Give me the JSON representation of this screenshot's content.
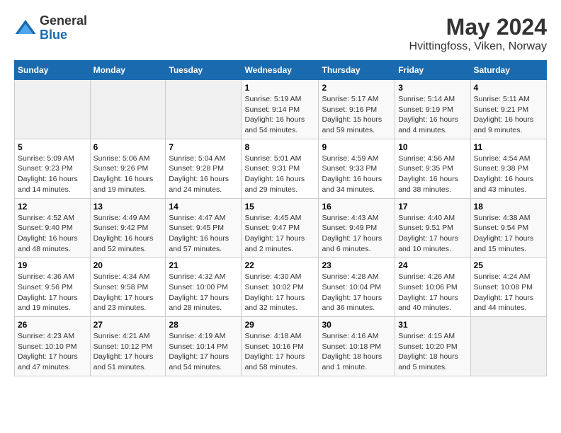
{
  "logo": {
    "general": "General",
    "blue": "Blue"
  },
  "title": "May 2024",
  "subtitle": "Hvittingfoss, Viken, Norway",
  "weekdays": [
    "Sunday",
    "Monday",
    "Tuesday",
    "Wednesday",
    "Thursday",
    "Friday",
    "Saturday"
  ],
  "weeks": [
    [
      {
        "day": "",
        "sunrise": "",
        "sunset": "",
        "daylight": ""
      },
      {
        "day": "",
        "sunrise": "",
        "sunset": "",
        "daylight": ""
      },
      {
        "day": "",
        "sunrise": "",
        "sunset": "",
        "daylight": ""
      },
      {
        "day": "1",
        "sunrise": "Sunrise: 5:19 AM",
        "sunset": "Sunset: 9:14 PM",
        "daylight": "Daylight: 16 hours and 54 minutes."
      },
      {
        "day": "2",
        "sunrise": "Sunrise: 5:17 AM",
        "sunset": "Sunset: 9:16 PM",
        "daylight": "Daylight: 15 hours and 59 minutes."
      },
      {
        "day": "3",
        "sunrise": "Sunrise: 5:14 AM",
        "sunset": "Sunset: 9:19 PM",
        "daylight": "Daylight: 16 hours and 4 minutes."
      },
      {
        "day": "4",
        "sunrise": "Sunrise: 5:11 AM",
        "sunset": "Sunset: 9:21 PM",
        "daylight": "Daylight: 16 hours and 9 minutes."
      }
    ],
    [
      {
        "day": "5",
        "sunrise": "Sunrise: 5:09 AM",
        "sunset": "Sunset: 9:23 PM",
        "daylight": "Daylight: 16 hours and 14 minutes."
      },
      {
        "day": "6",
        "sunrise": "Sunrise: 5:06 AM",
        "sunset": "Sunset: 9:26 PM",
        "daylight": "Daylight: 16 hours and 19 minutes."
      },
      {
        "day": "7",
        "sunrise": "Sunrise: 5:04 AM",
        "sunset": "Sunset: 9:28 PM",
        "daylight": "Daylight: 16 hours and 24 minutes."
      },
      {
        "day": "8",
        "sunrise": "Sunrise: 5:01 AM",
        "sunset": "Sunset: 9:31 PM",
        "daylight": "Daylight: 16 hours and 29 minutes."
      },
      {
        "day": "9",
        "sunrise": "Sunrise: 4:59 AM",
        "sunset": "Sunset: 9:33 PM",
        "daylight": "Daylight: 16 hours and 34 minutes."
      },
      {
        "day": "10",
        "sunrise": "Sunrise: 4:56 AM",
        "sunset": "Sunset: 9:35 PM",
        "daylight": "Daylight: 16 hours and 38 minutes."
      },
      {
        "day": "11",
        "sunrise": "Sunrise: 4:54 AM",
        "sunset": "Sunset: 9:38 PM",
        "daylight": "Daylight: 16 hours and 43 minutes."
      }
    ],
    [
      {
        "day": "12",
        "sunrise": "Sunrise: 4:52 AM",
        "sunset": "Sunset: 9:40 PM",
        "daylight": "Daylight: 16 hours and 48 minutes."
      },
      {
        "day": "13",
        "sunrise": "Sunrise: 4:49 AM",
        "sunset": "Sunset: 9:42 PM",
        "daylight": "Daylight: 16 hours and 52 minutes."
      },
      {
        "day": "14",
        "sunrise": "Sunrise: 4:47 AM",
        "sunset": "Sunset: 9:45 PM",
        "daylight": "Daylight: 16 hours and 57 minutes."
      },
      {
        "day": "15",
        "sunrise": "Sunrise: 4:45 AM",
        "sunset": "Sunset: 9:47 PM",
        "daylight": "Daylight: 17 hours and 2 minutes."
      },
      {
        "day": "16",
        "sunrise": "Sunrise: 4:43 AM",
        "sunset": "Sunset: 9:49 PM",
        "daylight": "Daylight: 17 hours and 6 minutes."
      },
      {
        "day": "17",
        "sunrise": "Sunrise: 4:40 AM",
        "sunset": "Sunset: 9:51 PM",
        "daylight": "Daylight: 17 hours and 10 minutes."
      },
      {
        "day": "18",
        "sunrise": "Sunrise: 4:38 AM",
        "sunset": "Sunset: 9:54 PM",
        "daylight": "Daylight: 17 hours and 15 minutes."
      }
    ],
    [
      {
        "day": "19",
        "sunrise": "Sunrise: 4:36 AM",
        "sunset": "Sunset: 9:56 PM",
        "daylight": "Daylight: 17 hours and 19 minutes."
      },
      {
        "day": "20",
        "sunrise": "Sunrise: 4:34 AM",
        "sunset": "Sunset: 9:58 PM",
        "daylight": "Daylight: 17 hours and 23 minutes."
      },
      {
        "day": "21",
        "sunrise": "Sunrise: 4:32 AM",
        "sunset": "Sunset: 10:00 PM",
        "daylight": "Daylight: 17 hours and 28 minutes."
      },
      {
        "day": "22",
        "sunrise": "Sunrise: 4:30 AM",
        "sunset": "Sunset: 10:02 PM",
        "daylight": "Daylight: 17 hours and 32 minutes."
      },
      {
        "day": "23",
        "sunrise": "Sunrise: 4:28 AM",
        "sunset": "Sunset: 10:04 PM",
        "daylight": "Daylight: 17 hours and 36 minutes."
      },
      {
        "day": "24",
        "sunrise": "Sunrise: 4:26 AM",
        "sunset": "Sunset: 10:06 PM",
        "daylight": "Daylight: 17 hours and 40 minutes."
      },
      {
        "day": "25",
        "sunrise": "Sunrise: 4:24 AM",
        "sunset": "Sunset: 10:08 PM",
        "daylight": "Daylight: 17 hours and 44 minutes."
      }
    ],
    [
      {
        "day": "26",
        "sunrise": "Sunrise: 4:23 AM",
        "sunset": "Sunset: 10:10 PM",
        "daylight": "Daylight: 17 hours and 47 minutes."
      },
      {
        "day": "27",
        "sunrise": "Sunrise: 4:21 AM",
        "sunset": "Sunset: 10:12 PM",
        "daylight": "Daylight: 17 hours and 51 minutes."
      },
      {
        "day": "28",
        "sunrise": "Sunrise: 4:19 AM",
        "sunset": "Sunset: 10:14 PM",
        "daylight": "Daylight: 17 hours and 54 minutes."
      },
      {
        "day": "29",
        "sunrise": "Sunrise: 4:18 AM",
        "sunset": "Sunset: 10:16 PM",
        "daylight": "Daylight: 17 hours and 58 minutes."
      },
      {
        "day": "30",
        "sunrise": "Sunrise: 4:16 AM",
        "sunset": "Sunset: 10:18 PM",
        "daylight": "Daylight: 18 hours and 1 minute."
      },
      {
        "day": "31",
        "sunrise": "Sunrise: 4:15 AM",
        "sunset": "Sunset: 10:20 PM",
        "daylight": "Daylight: 18 hours and 5 minutes."
      },
      {
        "day": "",
        "sunrise": "",
        "sunset": "",
        "daylight": ""
      }
    ]
  ]
}
